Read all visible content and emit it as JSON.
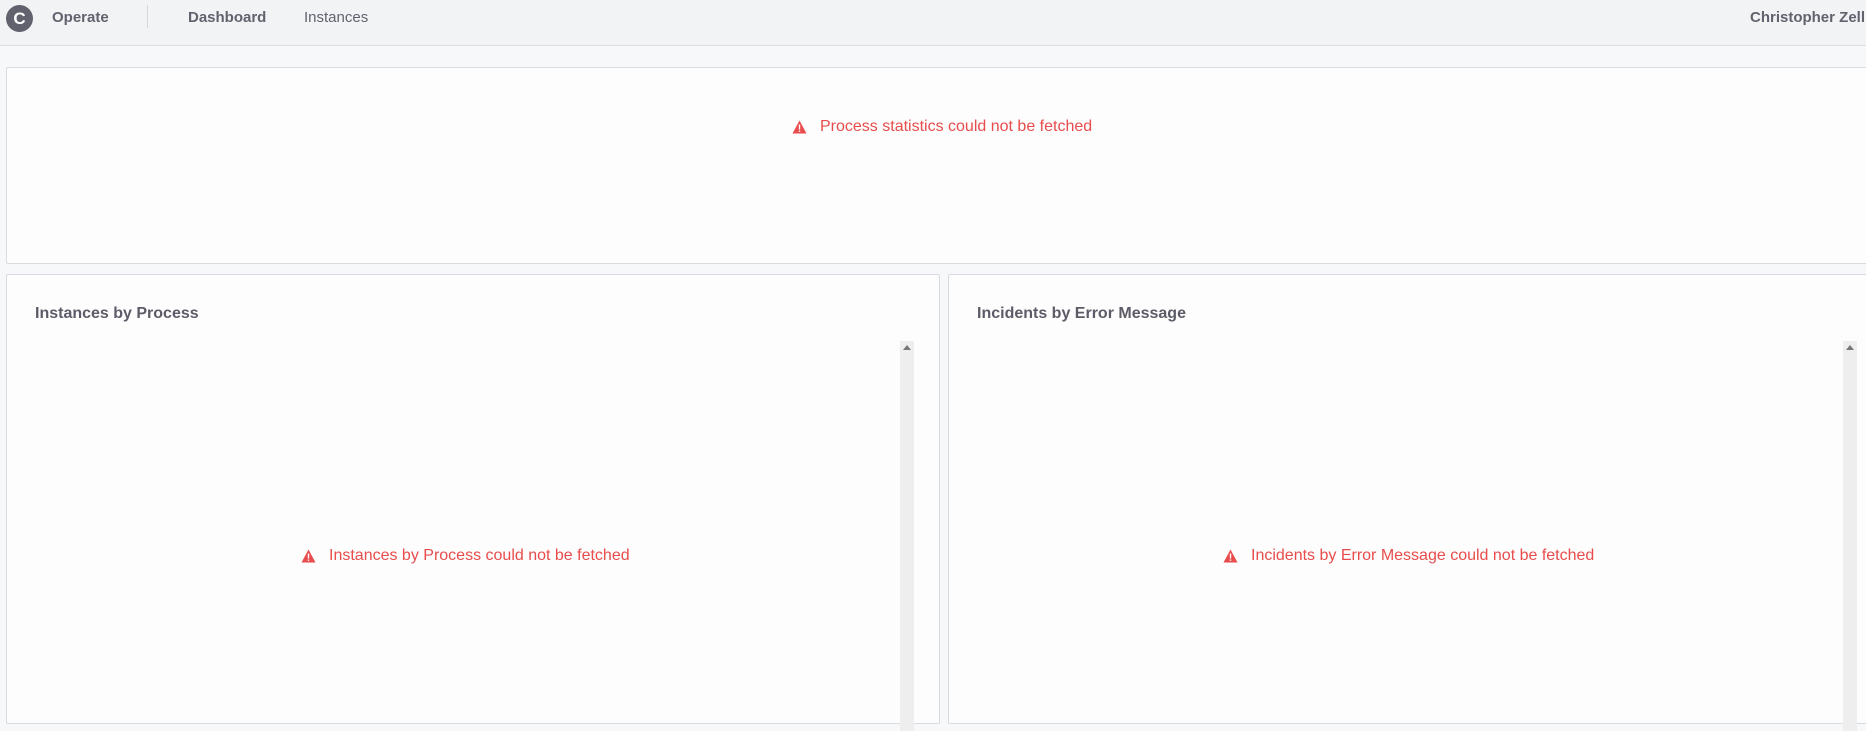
{
  "header": {
    "logo_letter": "C",
    "brand": "Operate",
    "nav": [
      "Dashboard",
      "Instances"
    ],
    "user": "Christopher Zell"
  },
  "stats_panel": {
    "error": "Process statistics could not be fetched"
  },
  "instances_panel": {
    "title": "Instances by Process",
    "error": "Instances by Process could not be fetched"
  },
  "incidents_panel": {
    "title": "Incidents by Error Message",
    "error": "Incidents by Error Message could not be fetched"
  },
  "colors": {
    "error": "#e84c4c",
    "text": "#62626e",
    "header_bg": "#f2f3f5"
  },
  "icons": {
    "error": "warning-triangle-icon"
  }
}
